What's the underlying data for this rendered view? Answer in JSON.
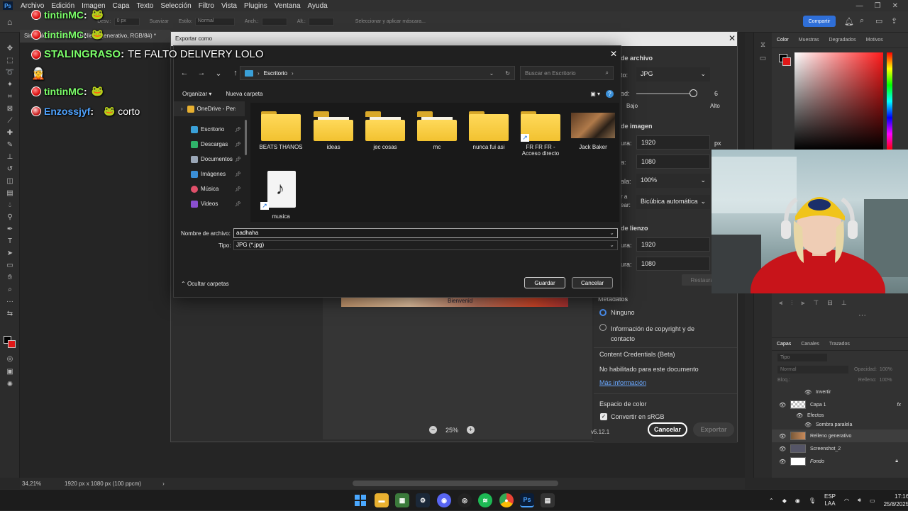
{
  "photoshop": {
    "logo": "Ps",
    "menu": [
      "Archivo",
      "Edición",
      "Imagen",
      "Capa",
      "Texto",
      "Selección",
      "Filtro",
      "Vista",
      "Plugins",
      "Ventana",
      "Ayuda"
    ],
    "options": {
      "difuminado_label": "Desv.:",
      "difuminado_value": "0 px",
      "suavizar": "Suavizar",
      "estilo_label": "Estilo:",
      "estilo_value": "Normal",
      "anch": "Anch.:",
      "alt": "Alt.:",
      "select_mask": "Seleccionar y aplicar máscara..."
    },
    "share_label": "Compartir",
    "doc_tab": "Sin título-1 @ 34,2% (Relleno generativo, RGB/8#) *",
    "status_zoom": "34,21%",
    "status_info": "1920 px x 1080 px (100 ppcm)",
    "panels": {
      "color_tabs": [
        "Color",
        "Muestras",
        "Degradados",
        "Motivos"
      ],
      "layer_tabs": [
        "Capas",
        "Canales",
        "Trazados"
      ],
      "layer_search": "Tipo",
      "blend_mode": "Normal",
      "opacity_label": "Opacidad:",
      "opacity_value": "100%",
      "lock_label": "Bloq.:",
      "fill_label": "Relleno:",
      "fill_value": "100%",
      "layers": [
        {
          "name": "Invertir",
          "indent": true
        },
        {
          "name": "Capa 1",
          "fx": "fx"
        },
        {
          "name": "Efectos",
          "indent": true
        },
        {
          "name": "Sombra paralela",
          "indent": true
        },
        {
          "name": "Relleno generativo",
          "selected": true
        },
        {
          "name": "Screenshot_2"
        },
        {
          "name": "Fondo",
          "italic": true
        }
      ]
    }
  },
  "export_dialog": {
    "title": "Exportar como",
    "section_file": "de archivo",
    "format_label": "to:",
    "format_value": "JPG",
    "quality_label": "ad:",
    "quality_value": "6",
    "quality_low": "Bajo",
    "quality_high": "Alto",
    "section_image": "de imagen",
    "width_label": "ura:",
    "width_value": "1920",
    "px": "px",
    "height_label": "a:",
    "height_value": "1080",
    "scale_label": "ala:",
    "scale_value": "100%",
    "resample_label_1": "r a",
    "resample_label_2": "ear:",
    "resample_value": "Bicúbica automática",
    "section_canvas": "de lienzo",
    "canvas_width_label": "ura:",
    "canvas_width_value": "1920",
    "canvas_height_label": "ura:",
    "canvas_height_value": "1080",
    "restore": "Restaurar",
    "metadata_label": "Metadatos",
    "meta_none": "Ninguno",
    "meta_copyright": "Información de copyright y de contacto",
    "credentials_label": "Content Credentials (Beta)",
    "credentials_status": "No habilitado para este documento",
    "more_info": "Más información",
    "colorspace_label": "Espacio de color",
    "convert_srgb": "Convertir en sRGB",
    "zoom_value": "25%",
    "version": "v5.12.1",
    "cancel": "Cancelar",
    "export": "Exportar",
    "preview_text": "Bienvenid"
  },
  "save_dialog": {
    "address_path": "Escritorio",
    "search_placeholder": "Buscar en Escritorio",
    "organize": "Organizar",
    "new_folder": "Nueva carpeta",
    "nav": [
      {
        "label": "OneDrive - Personal",
        "color": "#e8b030",
        "pinned": false,
        "expander": true
      },
      {
        "label": "Escritorio",
        "color": "#3aa0d8",
        "pinned": true
      },
      {
        "label": "Descargas",
        "color": "#2fb36a",
        "pinned": true
      },
      {
        "label": "Documentos",
        "color": "#9aa6b6",
        "pinned": true
      },
      {
        "label": "Imágenes",
        "color": "#3a8fd8",
        "pinned": true
      },
      {
        "label": "Música",
        "color": "#e0506a",
        "pinned": true
      },
      {
        "label": "Videos",
        "color": "#8a4fd0",
        "pinned": true
      }
    ],
    "items": [
      {
        "name": "BEATS THANOS",
        "kind": "folder"
      },
      {
        "name": "ideas",
        "kind": "folder-docs"
      },
      {
        "name": "jec cosas",
        "kind": "folder-docs"
      },
      {
        "name": "mc",
        "kind": "folder-docs"
      },
      {
        "name": "nunca fui asi",
        "kind": "folder"
      },
      {
        "name": "FR FR FR - Acceso directo",
        "kind": "shortcut"
      },
      {
        "name": "Jack Baker",
        "kind": "image"
      },
      {
        "name": "musica",
        "kind": "music"
      }
    ],
    "filename_label": "Nombre de archivo:",
    "filename_value": "aadhaha",
    "type_label": "Tipo:",
    "type_value": "JPG (*.jpg)",
    "hide_folders": "Ocultar carpetas",
    "save": "Guardar",
    "cancel": "Cancelar"
  },
  "chat": [
    {
      "user": "tintinMC",
      "color": "#7cff6a",
      "text": ""
    },
    {
      "user": "tintinMC",
      "color": "#7cff6a",
      "text": ""
    },
    {
      "user": "STALINGRASO",
      "color": "#7cff6a",
      "text": "TE FALTO DELIVERY LOLO"
    },
    {
      "user": "tintinMC",
      "color": "#7cff6a",
      "text": ""
    },
    {
      "user": "Enzossjyf",
      "color": "#4fa3ff",
      "text": "corto"
    }
  ],
  "taskbar": {
    "lang_1": "ESP",
    "lang_2": "LAA",
    "time": "17:16",
    "date": "25/8/2025",
    "ps_label": "Ps"
  }
}
